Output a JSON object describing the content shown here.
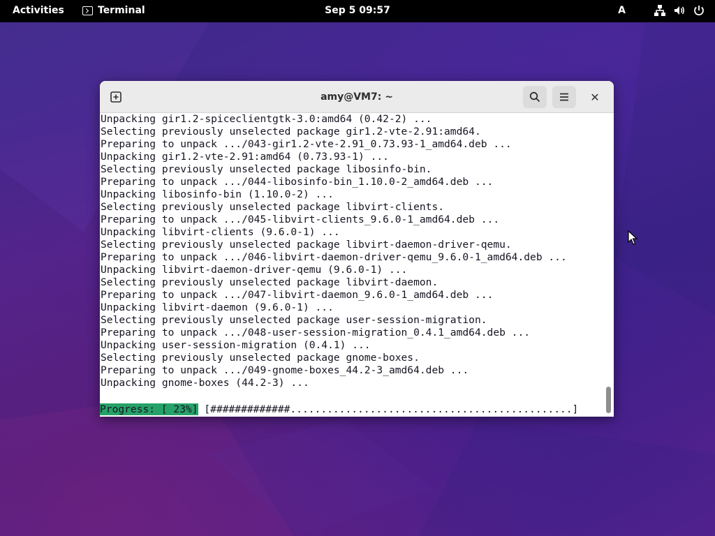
{
  "topbar": {
    "activities": "Activities",
    "app_name": "Terminal",
    "clock": "Sep 5  09:57",
    "keyboard_layout": "A",
    "icons": [
      "network-icon",
      "volume-icon",
      "power-icon"
    ]
  },
  "window": {
    "title": "amy@VM7: ~",
    "icons": [
      "new-tab-icon",
      "search-icon",
      "menu-icon",
      "close-icon"
    ],
    "close_glyph": "✕"
  },
  "terminal": {
    "lines": [
      "Unpacking gir1.2-spiceclientgtk-3.0:amd64 (0.42-2) ...",
      "Selecting previously unselected package gir1.2-vte-2.91:amd64.",
      "Preparing to unpack .../043-gir1.2-vte-2.91_0.73.93-1_amd64.deb ...",
      "Unpacking gir1.2-vte-2.91:amd64 (0.73.93-1) ...",
      "Selecting previously unselected package libosinfo-bin.",
      "Preparing to unpack .../044-libosinfo-bin_1.10.0-2_amd64.deb ...",
      "Unpacking libosinfo-bin (1.10.0-2) ...",
      "Selecting previously unselected package libvirt-clients.",
      "Preparing to unpack .../045-libvirt-clients_9.6.0-1_amd64.deb ...",
      "Unpacking libvirt-clients (9.6.0-1) ...",
      "Selecting previously unselected package libvirt-daemon-driver-qemu.",
      "Preparing to unpack .../046-libvirt-daemon-driver-qemu_9.6.0-1_amd64.deb ...",
      "Unpacking libvirt-daemon-driver-qemu (9.6.0-1) ...",
      "Selecting previously unselected package libvirt-daemon.",
      "Preparing to unpack .../047-libvirt-daemon_9.6.0-1_amd64.deb ...",
      "Unpacking libvirt-daemon (9.6.0-1) ...",
      "Selecting previously unselected package user-session-migration.",
      "Preparing to unpack .../048-user-session-migration_0.4.1_amd64.deb ...",
      "Unpacking user-session-migration (0.4.1) ...",
      "Selecting previously unselected package gnome-boxes.",
      "Preparing to unpack .../049-gnome-boxes_44.2-3_amd64.deb ...",
      "Unpacking gnome-boxes (44.2-3) ...",
      ""
    ],
    "progress_label": "Progress: [ 23%]",
    "progress_bar": " [#############..............................................]",
    "progress_color": "#26a269"
  }
}
